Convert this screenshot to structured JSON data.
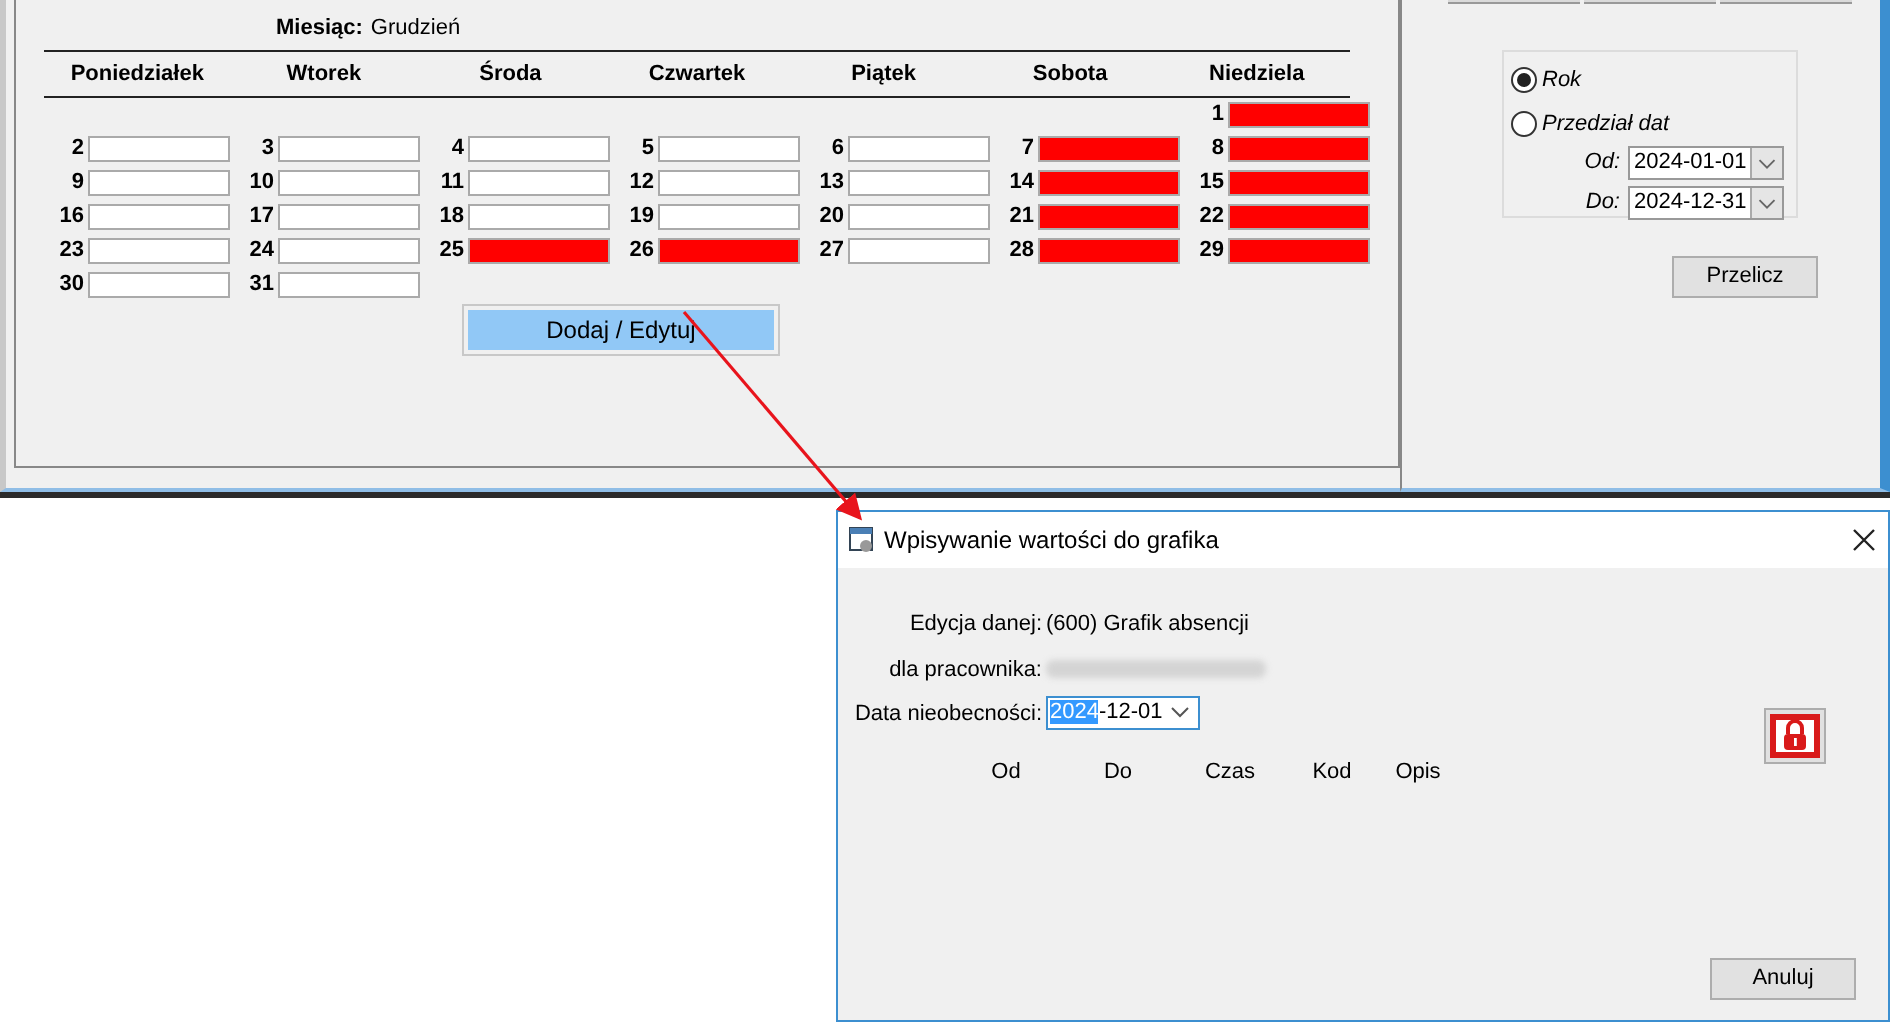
{
  "calendar": {
    "month_label": "Miesiąc:",
    "month": "Grudzień",
    "weekdays": [
      "Poniedziałek",
      "Wtorek",
      "Środa",
      "Czwartek",
      "Piątek",
      "Sobota",
      "Niedziela"
    ],
    "weeks": [
      {
        "starts_midweek": true,
        "days": [
          {
            "day": "1",
            "marked": true
          }
        ]
      },
      {
        "starts_midweek": false,
        "days": [
          {
            "day": "2",
            "marked": false
          },
          {
            "day": "3",
            "marked": false
          },
          {
            "day": "4",
            "marked": false
          },
          {
            "day": "5",
            "marked": false
          },
          {
            "day": "6",
            "marked": false
          },
          {
            "day": "7",
            "marked": true
          },
          {
            "day": "8",
            "marked": true
          }
        ]
      },
      {
        "starts_midweek": false,
        "days": [
          {
            "day": "9",
            "marked": false
          },
          {
            "day": "10",
            "marked": false
          },
          {
            "day": "11",
            "marked": false
          },
          {
            "day": "12",
            "marked": false
          },
          {
            "day": "13",
            "marked": false
          },
          {
            "day": "14",
            "marked": true
          },
          {
            "day": "15",
            "marked": true
          }
        ]
      },
      {
        "starts_midweek": false,
        "days": [
          {
            "day": "16",
            "marked": false
          },
          {
            "day": "17",
            "marked": false
          },
          {
            "day": "18",
            "marked": false
          },
          {
            "day": "19",
            "marked": false
          },
          {
            "day": "20",
            "marked": false
          },
          {
            "day": "21",
            "marked": true
          },
          {
            "day": "22",
            "marked": true
          }
        ]
      },
      {
        "starts_midweek": false,
        "days": [
          {
            "day": "23",
            "marked": false
          },
          {
            "day": "24",
            "marked": false
          },
          {
            "day": "25",
            "marked": true
          },
          {
            "day": "26",
            "marked": true
          },
          {
            "day": "27",
            "marked": false
          },
          {
            "day": "28",
            "marked": true
          },
          {
            "day": "29",
            "marked": true
          }
        ]
      },
      {
        "starts_midweek": false,
        "days": [
          {
            "day": "30",
            "marked": false
          },
          {
            "day": "31",
            "marked": false
          }
        ]
      }
    ],
    "button": "Dodaj / Edytuj"
  },
  "range": {
    "options": [
      {
        "label": "Rok",
        "selected": true
      },
      {
        "label": "Przedział dat",
        "selected": false
      }
    ],
    "from_label": "Od:",
    "from": "2024-01-01",
    "to_label": "Do:",
    "to": "2024-12-31",
    "button": "Przelicz"
  },
  "dialog": {
    "title": "Wpisywanie wartości do grafika",
    "edit_label": "Edycja danej:",
    "edit_value": "(600) Grafik absencji",
    "employee_label": "dla pracownika:",
    "date_label": "Data nieobecności:",
    "date_parts": [
      {
        "text": "2024",
        "selected": true
      },
      {
        "text": "-12-01",
        "selected": false
      }
    ],
    "columns": [
      "Od",
      "Do",
      "Czas",
      "Kod",
      "Opis"
    ],
    "button": "Anuluj"
  }
}
